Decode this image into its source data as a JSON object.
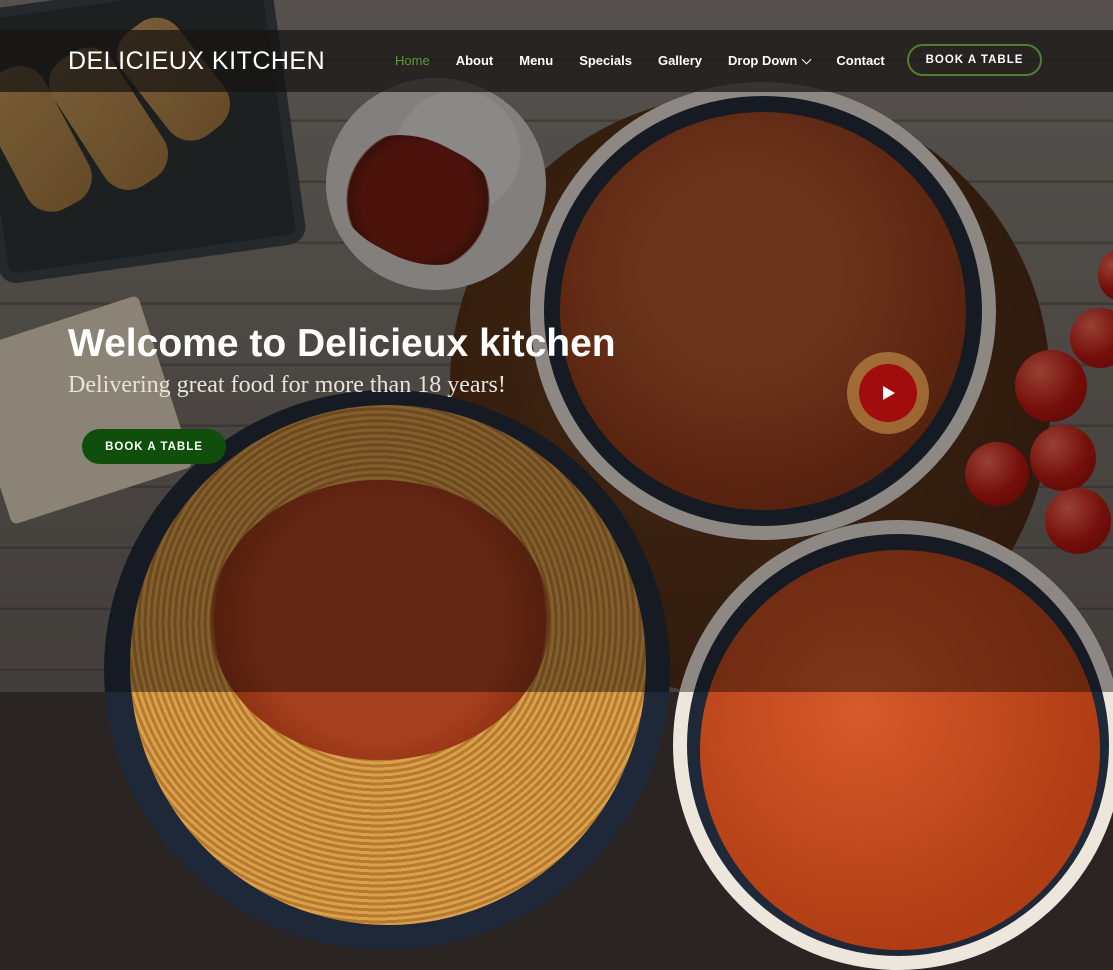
{
  "header": {
    "logo": "DELICIEUX KITCHEN",
    "nav": [
      {
        "label": "Home"
      },
      {
        "label": "About"
      },
      {
        "label": "Menu"
      },
      {
        "label": "Specials"
      },
      {
        "label": "Gallery"
      },
      {
        "label": "Drop Down"
      },
      {
        "label": "Contact"
      }
    ],
    "active_nav": "Home",
    "cta": "BOOK A TABLE"
  },
  "hero": {
    "title": "Welcome to Delicieux kitchen",
    "subtitle": "Delivering great food for more than 18 years!",
    "cta": "BOOK A TABLE"
  },
  "colors": {
    "accent_green": "#5e9a3c",
    "cta_green": "#0f4f0b",
    "play_red": "#a10d0d"
  },
  "icons": {
    "dropdown": "chevron-down-icon",
    "video": "play-icon"
  }
}
